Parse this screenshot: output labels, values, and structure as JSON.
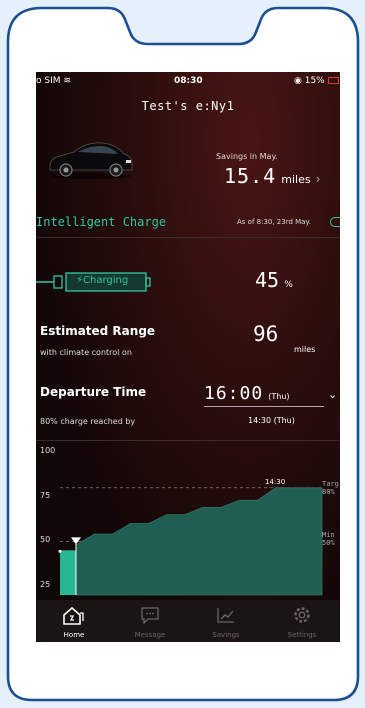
{
  "status": {
    "carrier": "o SIM",
    "time": "08:30",
    "battery": "15%"
  },
  "title": "Test's e:Ny1",
  "savings": {
    "label": "Savings in May.",
    "value": "15.4",
    "unit": "miles"
  },
  "section": {
    "name": "Intelligent Charge",
    "asof": "As of 8:30, 23rd May."
  },
  "charging": {
    "label": "Charging",
    "percent": "45",
    "unit": "%"
  },
  "range": {
    "title": "Estimated Range",
    "subtitle": "with climate control on",
    "value": "96",
    "unit": "miles"
  },
  "departure": {
    "title": "Departure Time",
    "subtitle": "80% charge reached by",
    "time": "16:00",
    "day": "(Thu)",
    "reached": "14:30 (Thu)"
  },
  "chart_data": {
    "type": "area",
    "y_ticks": [
      "100",
      "75",
      "50",
      "25"
    ],
    "ylim": [
      20,
      100
    ],
    "annotation": "14:30",
    "target_label": [
      "Targ",
      "80%"
    ],
    "min_label": [
      "Min",
      "50%"
    ],
    "target": 80,
    "minimum": 50,
    "current": 45,
    "area_values": [
      48,
      54,
      54,
      60,
      60,
      65,
      65,
      69,
      69,
      73,
      73,
      80,
      80,
      80
    ]
  },
  "tabs": [
    {
      "label": "Home",
      "icon": "home-charger-icon"
    },
    {
      "label": "Message",
      "icon": "message-icon"
    },
    {
      "label": "Savings",
      "icon": "savings-chart-icon"
    },
    {
      "label": "Settings",
      "icon": "settings-gear-icon"
    }
  ],
  "colors": {
    "accent": "#2fc9a5",
    "area": "#1f5e50",
    "current": "#27b797"
  }
}
